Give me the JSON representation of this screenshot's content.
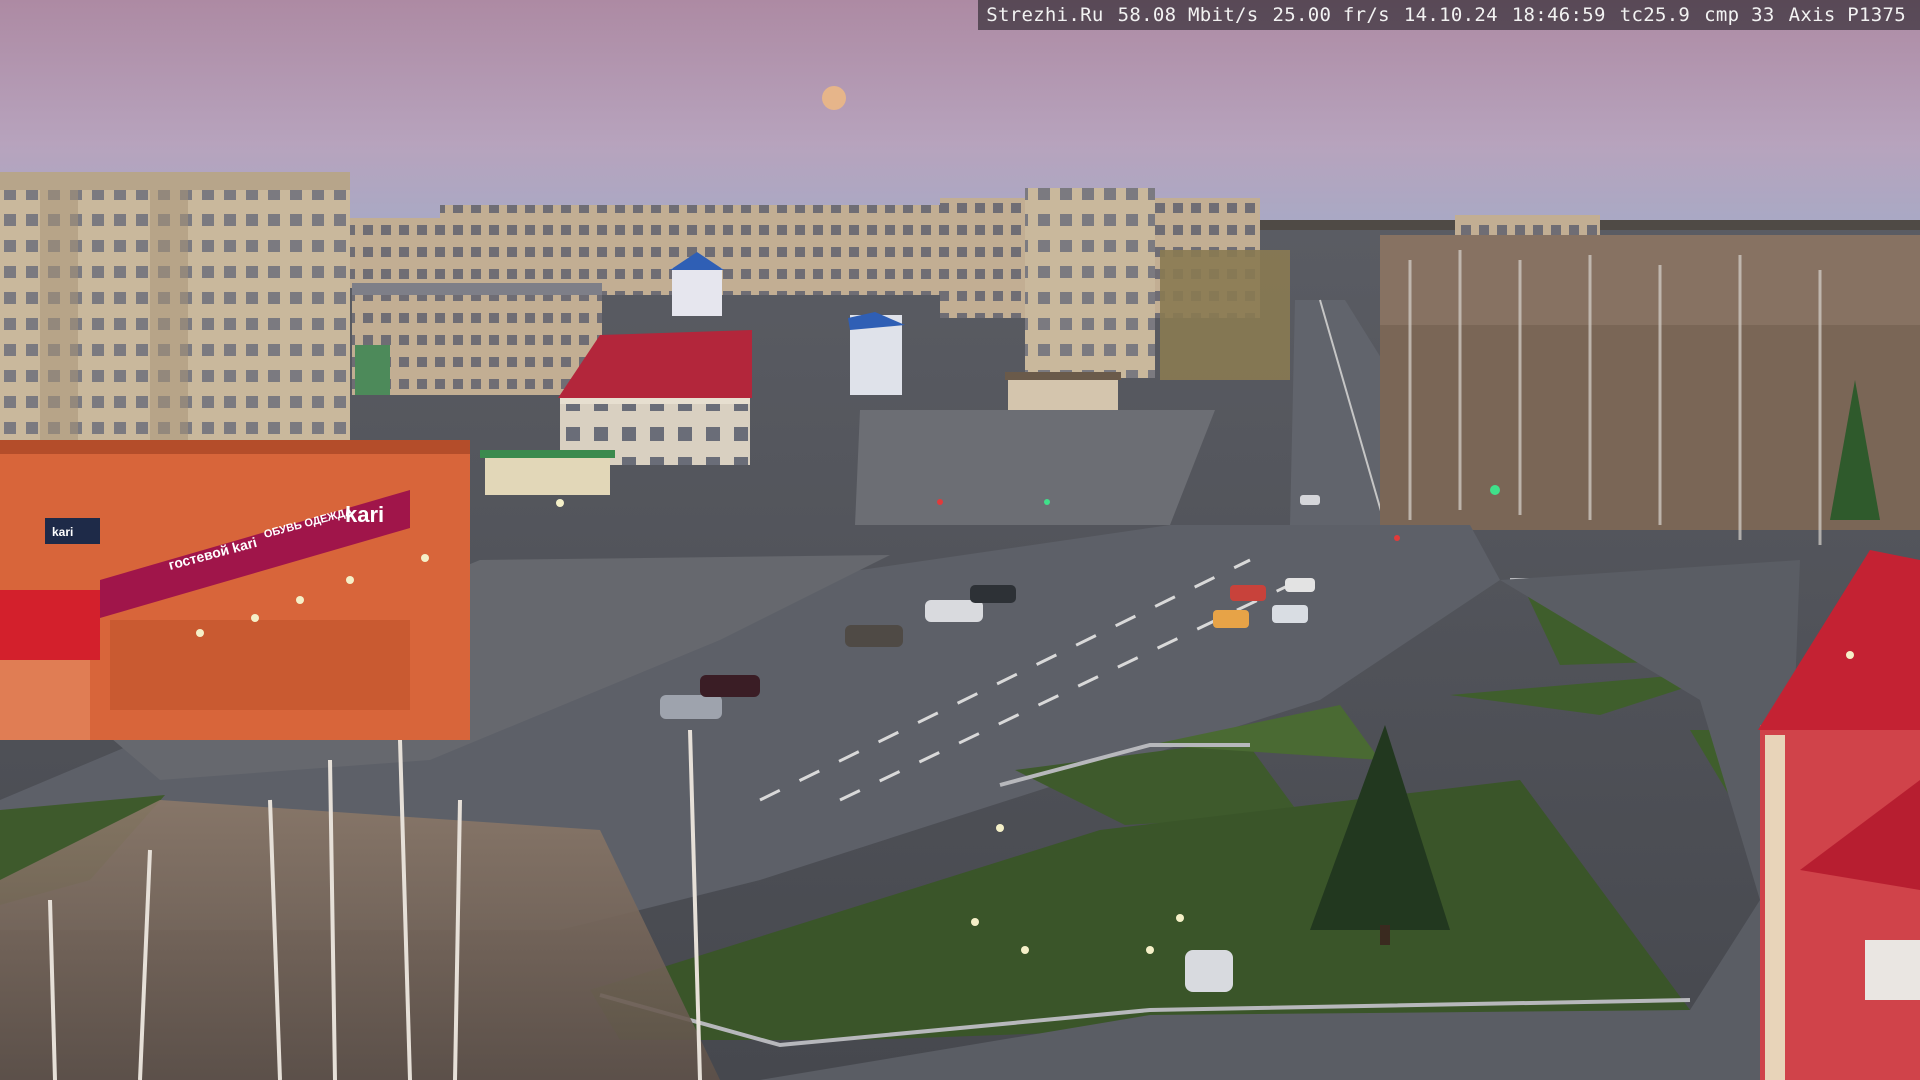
{
  "overlay": {
    "site": "Strezhi.Ru",
    "bitrate": "58.08 Mbit/s",
    "framerate": "25.00 fr/s",
    "date": "14.10.24",
    "time": "18:46:59",
    "tc": "tc25.9",
    "cmp": "cmp 33",
    "camera": "Axis P1375"
  },
  "signs": {
    "store_brand": "kari",
    "store_logo_small": "kari",
    "store_slogan": "гостевой kari",
    "store_slogan2": "ОБУВЬ ОДЕЖДА"
  },
  "colors": {
    "sky_top": "#b38a9e",
    "sky_bottom": "#a7a8c4",
    "moon": "#e6b58a",
    "road": "#5b5e66",
    "grass": "#3e5a2c",
    "store_orange": "#d8653a",
    "store_magenta": "#a0154a",
    "roof_red": "#b3263b"
  }
}
